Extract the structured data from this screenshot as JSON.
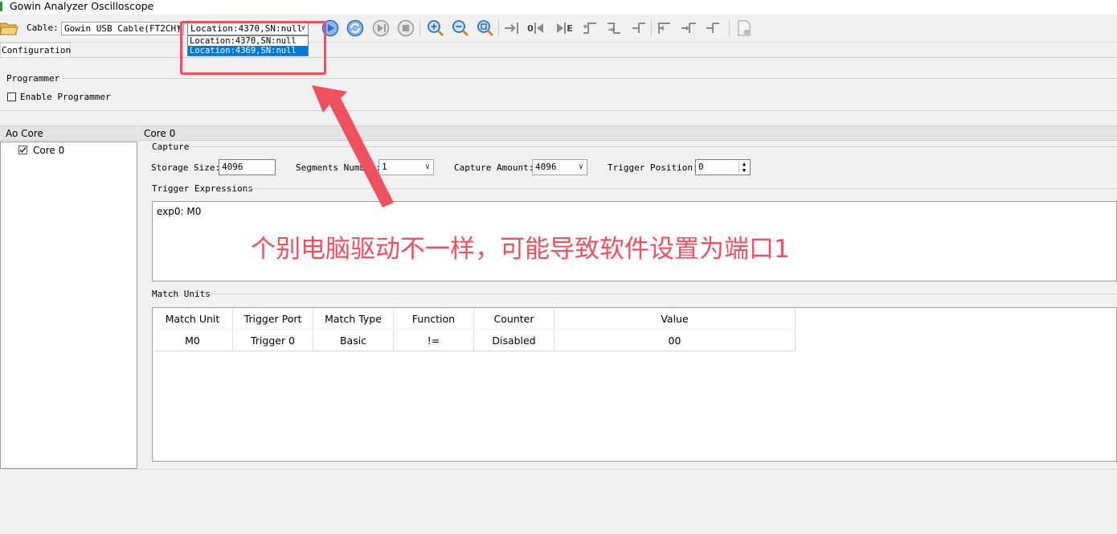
{
  "window": {
    "title": "Gowin Analyzer Oscilloscope"
  },
  "toolbar": {
    "cable_label": "Cable:",
    "cable_value": "Gowin USB Cable(FT2CH)",
    "location_value": "Location:4370,SN:null",
    "location_options": [
      "Location:4370,SN:null",
      "Location:4369,SN:null"
    ],
    "location_selected_index": 1,
    "icons": [
      "open-folder-icon",
      "run-icon",
      "repeat-run-icon",
      "step-icon",
      "stop-icon",
      "zoom-in-icon",
      "zoom-out-icon",
      "zoom-fit-icon",
      "goto-trigger-icon",
      "goto-start-icon",
      "goto-end-icon",
      "prev-rise-icon",
      "next-rise-icon",
      "prev-fall-icon",
      "next-fall-icon",
      "prev-edge-icon",
      "next-edge-icon",
      "export-icon"
    ],
    "goto_zero_label": "0",
    "goto_end_label": "E"
  },
  "tabs": [
    {
      "label": "Configuration",
      "active": true
    }
  ],
  "programmer": {
    "group_label": "Programmer",
    "enable_label": "Enable Programmer",
    "enable_checked": false
  },
  "left_panel": {
    "header": "Ao Core",
    "items": [
      {
        "label": "Core 0",
        "checked": true
      }
    ]
  },
  "core": {
    "header": "Core 0",
    "capture": {
      "group_label": "Capture",
      "storage_size_label": "Storage Size:",
      "storage_size_value": "4096",
      "segments_label": "Segments Number:",
      "segments_value": "1",
      "capture_amount_label": "Capture Amount:",
      "capture_amount_value": "4096",
      "trigger_position_label": "Trigger Position:",
      "trigger_position_value": "0"
    },
    "trigger_expressions": {
      "group_label": "Trigger Expressions",
      "text": "exp0:  M0"
    },
    "match_units": {
      "group_label": "Match Units",
      "columns": [
        "Match Unit",
        "Trigger Port",
        "Match Type",
        "Function",
        "Counter",
        "Value"
      ],
      "rows": [
        [
          "M0",
          "Trigger 0",
          "Basic",
          "!=",
          "Disabled",
          "00"
        ]
      ]
    }
  },
  "annotation": {
    "text": "个别电脑驱动不一样，可能导致软件设置为端口1",
    "color": "#f04f5d"
  },
  "colors": {
    "accent_selected": "#0078d7",
    "annotation_red": "#f04f5d",
    "toolbar_blue": "#2a6fcf"
  }
}
